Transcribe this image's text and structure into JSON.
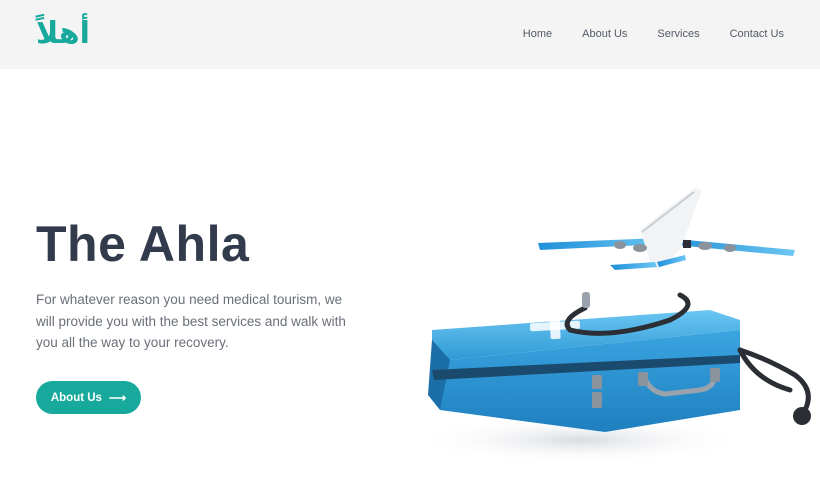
{
  "brand": {
    "logo_text": "أهلاً"
  },
  "nav": {
    "items": [
      {
        "label": "Home"
      },
      {
        "label": "About Us"
      },
      {
        "label": "Services"
      },
      {
        "label": "Contact Us"
      }
    ]
  },
  "hero": {
    "title": "The Ahla",
    "description": "For whatever reason you need medical tourism, we will provide you with the best services and walk with you all the way to your recovery.",
    "button_label": "About Us",
    "button_icon": "arrow-right-icon"
  },
  "illustration": {
    "subject": "airplane-over-medical-suitcase-with-stethoscope"
  },
  "colors": {
    "accent": "#17a99b",
    "heading": "#323b4c",
    "body_text": "#6a6f78",
    "header_bg": "#f4f4f4",
    "suitcase_blue": "#2f9ad6"
  }
}
